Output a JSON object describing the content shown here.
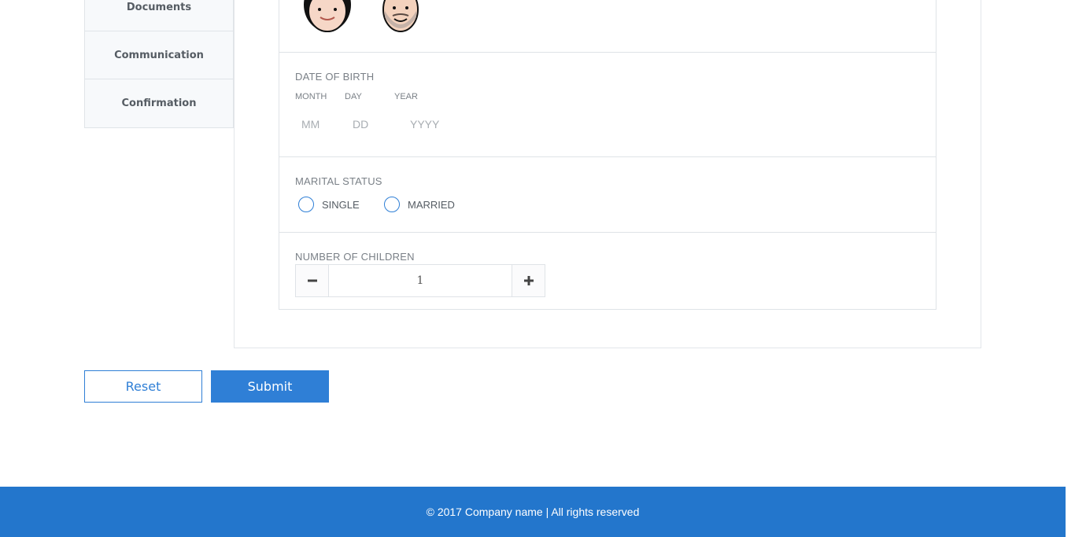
{
  "sidebar": {
    "items": [
      {
        "label": "Documents"
      },
      {
        "label": "Communication"
      },
      {
        "label": "Confirmation"
      }
    ]
  },
  "avatars": [
    {
      "name": "female-avatar"
    },
    {
      "name": "male-avatar"
    }
  ],
  "dob": {
    "label": "DATE OF BIRTH",
    "month": {
      "label": "MONTH",
      "placeholder": "MM",
      "value": ""
    },
    "day": {
      "label": "DAY",
      "placeholder": "DD",
      "value": ""
    },
    "year": {
      "label": "YEAR",
      "placeholder": "YYYY",
      "value": ""
    }
  },
  "marital": {
    "label": "MARITAL STATUS",
    "options": [
      {
        "label": "SINGLE",
        "selected": false
      },
      {
        "label": "MARRIED",
        "selected": false
      }
    ]
  },
  "children": {
    "label": "NUMBER OF CHILDREN",
    "value": "1",
    "minus_icon": "minus-icon",
    "plus_icon": "plus-icon"
  },
  "actions": {
    "reset_label": "Reset",
    "submit_label": "Submit"
  },
  "footer": {
    "text": "© 2017 Company name | All rights reserved"
  },
  "colors": {
    "accent": "#2f7fd6",
    "footer_bg": "#2376cc"
  }
}
